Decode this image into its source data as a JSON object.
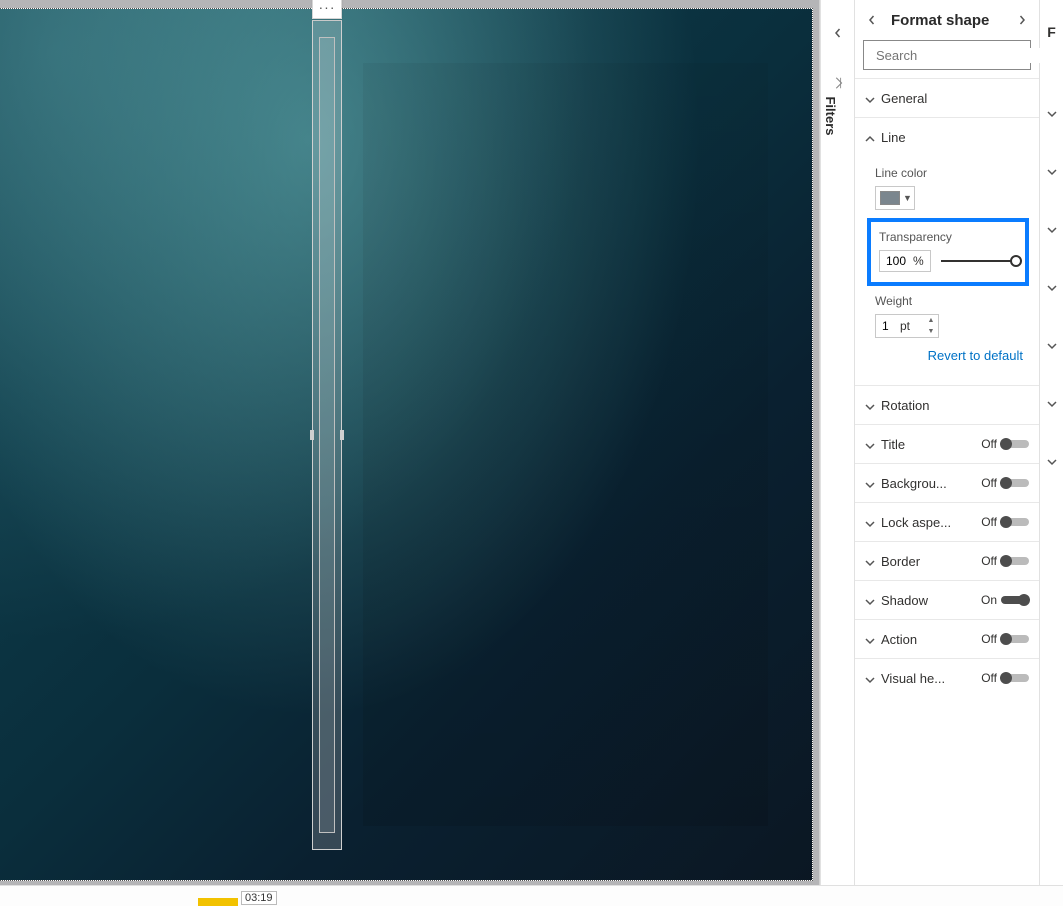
{
  "filters": {
    "label": "Filters"
  },
  "pane": {
    "title": "Format shape",
    "search_placeholder": "Search",
    "sections": {
      "general": {
        "label": "General",
        "expanded": false
      },
      "line": {
        "label": "Line",
        "expanded": true,
        "line_color_label": "Line color",
        "line_color_value": "#7b868e",
        "transparency": {
          "label": "Transparency",
          "value": "100",
          "unit": "%"
        },
        "weight": {
          "label": "Weight",
          "value": "1",
          "unit": "pt"
        },
        "revert_label": "Revert to default"
      },
      "rotation": {
        "label": "Rotation"
      },
      "title": {
        "label": "Title",
        "toggle_state": "Off"
      },
      "background": {
        "label": "Backgrou...",
        "toggle_state": "Off"
      },
      "lock_aspect": {
        "label": "Lock aspe...",
        "toggle_state": "Off"
      },
      "border": {
        "label": "Border",
        "toggle_state": "Off"
      },
      "shadow": {
        "label": "Shadow",
        "toggle_state": "On"
      },
      "action": {
        "label": "Action",
        "toggle_state": "Off"
      },
      "visual_header": {
        "label": "Visual he...",
        "toggle_state": "Off"
      }
    }
  },
  "right_sliver": {
    "letter": "F"
  },
  "bottom": {
    "time": "03:19"
  },
  "icons": {
    "ellipsis": "···"
  }
}
